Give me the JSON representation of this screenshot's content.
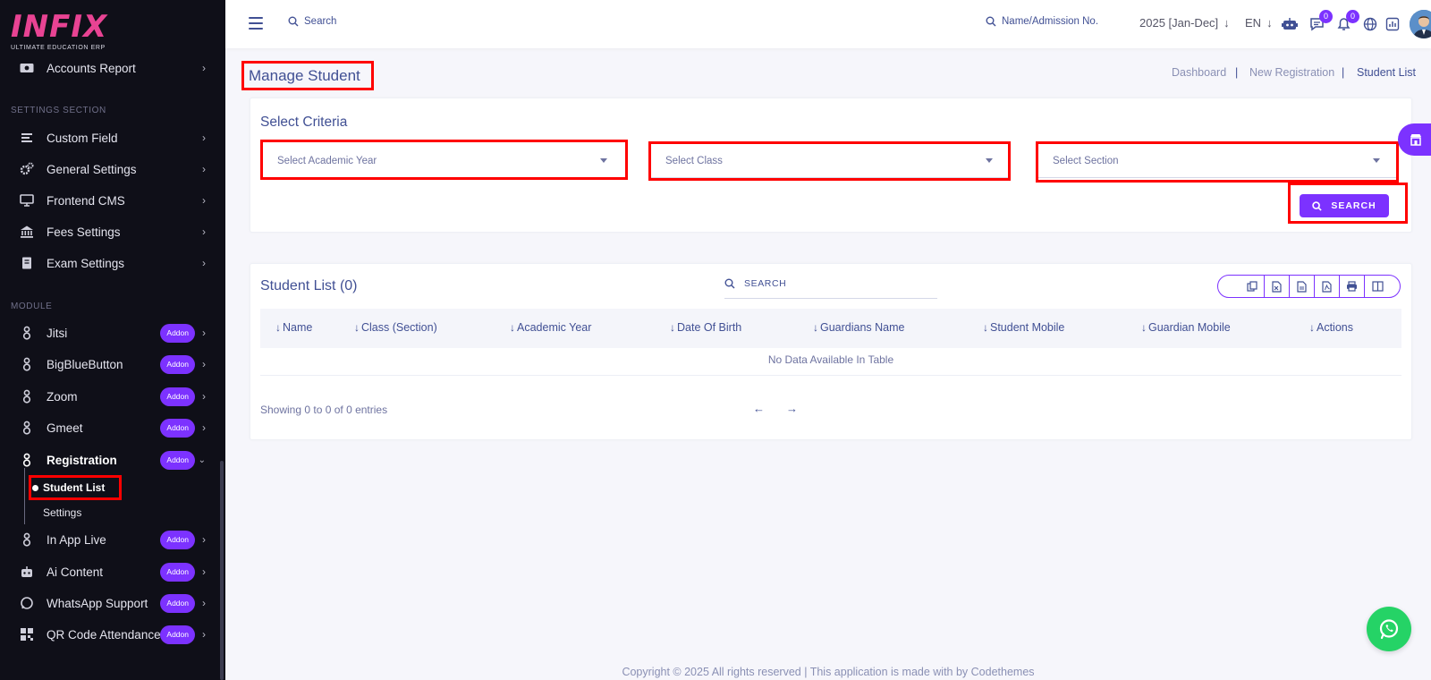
{
  "brand": {
    "logo_text": "INFIX",
    "logo_sub": "ULTIMATE EDUCATION ERP"
  },
  "sidebar": {
    "top_item": "Accounts Report",
    "section_settings": "SETTINGS SECTION",
    "settings_items": [
      "Custom Field",
      "General Settings",
      "Frontend CMS",
      "Fees Settings",
      "Exam Settings"
    ],
    "section_module": "MODULE",
    "addon_label": "Addon",
    "modules": [
      "Jitsi",
      "BigBlueButton",
      "Zoom",
      "Gmeet",
      "Registration"
    ],
    "registration_sub": [
      "Student List",
      "Settings"
    ],
    "modules_after": [
      "In App Live",
      "Ai Content",
      "WhatsApp Support",
      "QR Code Attendance"
    ]
  },
  "topbar": {
    "search_label": "Search",
    "admission_search": "Name/Admission No.",
    "year": "2025 [Jan-Dec]",
    "lang": "EN",
    "messages_count": "0",
    "notifications_count": "0"
  },
  "page": {
    "title": "Manage Student",
    "breadcrumb": [
      "Dashboard",
      "New Registration",
      "Student List"
    ],
    "breadcrumb_sep": "|"
  },
  "criteria": {
    "title": "Select Criteria",
    "academic_year_placeholder": "Select Academic Year",
    "class_placeholder": "Select Class",
    "section_placeholder": "Select Section",
    "search_button": "SEARCH"
  },
  "student_list": {
    "title": "Student List (0)",
    "search_placeholder": "SEARCH",
    "columns": [
      "Name",
      "Class (Section)",
      "Academic Year",
      "Date Of Birth",
      "Guardians Name",
      "Student Mobile",
      "Guardian Mobile",
      "Actions"
    ],
    "empty_text": "No Data Available In Table",
    "showing": "Showing 0 to 0 of 0 entries",
    "prev": "←",
    "next": "→"
  },
  "footer": {
    "text": "Copyright © 2025 All rights reserved | This application is made with by Codethemes"
  },
  "colors": {
    "accent": "#7c32ff",
    "text": "#415094",
    "highlight": "#ff0000",
    "sidebar_bg": "#0f0f18",
    "whatsapp": "#25d366"
  }
}
